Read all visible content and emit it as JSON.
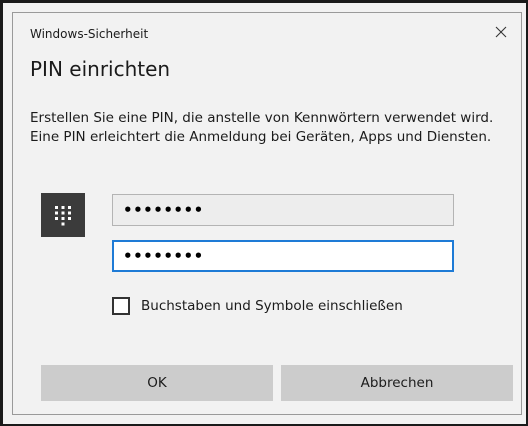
{
  "window": {
    "app_title": "Windows-Sicherheit",
    "close_glyph": "×"
  },
  "dialog": {
    "heading": "PIN einrichten",
    "description": "Erstellen Sie eine PIN, die anstelle von Kennwörtern verwendet wird. Eine PIN erleichtert die Anmeldung bei Geräten, Apps und Diensten.",
    "keypad_icon": "keypad-icon",
    "new_pin": {
      "value": "••••••••"
    },
    "confirm_pin": {
      "value": "••••••••"
    },
    "include_letters_symbols": {
      "label": "Buchstaben und Symbole einschließen",
      "checked": false
    },
    "buttons": {
      "ok": "OK",
      "cancel": "Abbrechen"
    }
  },
  "colors": {
    "focus_border": "#1e7bd6",
    "button_bg": "#cccccc",
    "icon_bg": "#3b3b3b"
  }
}
